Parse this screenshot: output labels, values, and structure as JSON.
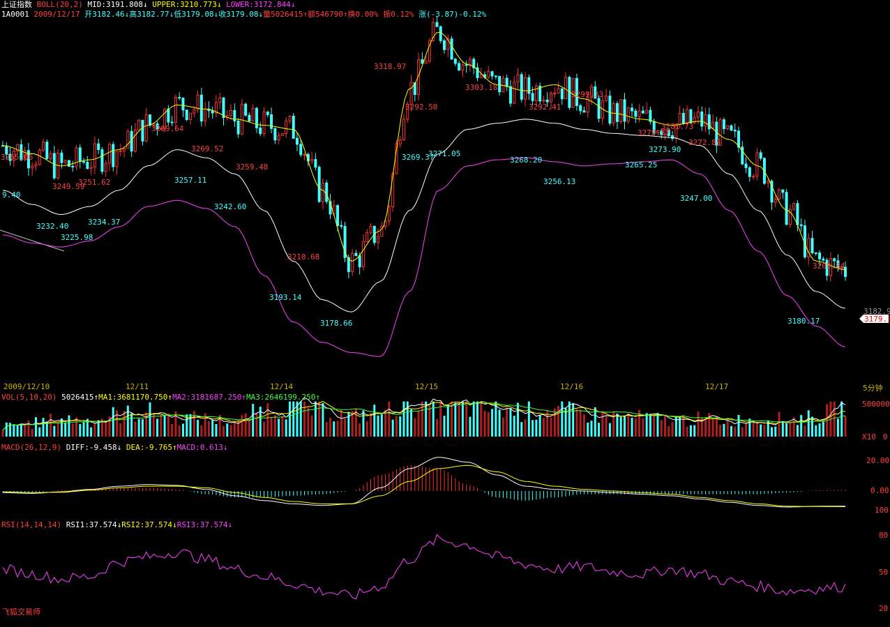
{
  "header": {
    "index_name": "上证指数",
    "boll_label": "BOLL(20,2)",
    "mid": "MID:3191.808↓",
    "upper": "UPPER:3210.773↓",
    "lower": "LOWER:3172.844↓",
    "code": "1A0001",
    "date": "2009/12/17",
    "open": "开3182.46↓",
    "high": "高3182.77↓",
    "low": "低3179.08↓",
    "close": "收3179.08↓",
    "volume": "量5026415↑",
    "amount": "额546790↑",
    "turnover": "换0.00%",
    "amplitude": "振0.12%",
    "change": "涨(-3.87)-0.12%"
  },
  "price_labels": {
    "l1": "3265.06",
    "l2": "9.40",
    "l3": "3249.59",
    "l4": "3251.62",
    "l5": "3232.40",
    "l6": "3225.98",
    "l7": "3234.37",
    "l8": "3289.64",
    "l9": "3269.52",
    "l10": "3257.11",
    "l11": "3259.48",
    "l12": "3242.60",
    "l13": "3210.68",
    "l14": "3193.14",
    "l15": "3178.66",
    "l16": "3318.97",
    "l17": "3292.50",
    "l18": "3269.37",
    "l19": "3271.05",
    "l20": "3303.18",
    "l21": "3292.41",
    "l22": "3268.20",
    "l23": "3256.13",
    "l24": "3299.33",
    "l25": "3278.57",
    "l26": "3281.73",
    "l27": "3273.90",
    "l28": "3265.25",
    "l29": "3272.85",
    "l30": "3247.00",
    "l31": "3205.84",
    "l32": "3180.17"
  },
  "price_axis": {
    "last_price": "3182.9",
    "current_price": "3179.1"
  },
  "date_axis": {
    "d1": "2009/12/10",
    "d2": "12/11",
    "d3": "12/14",
    "d4": "12/15",
    "d5": "12/16",
    "d6": "12/17",
    "period": "5分钟"
  },
  "vol_header": {
    "name": "VOL(5,10,20)",
    "value": "5026415↑",
    "ma1": "MA1:3681170.750↑",
    "ma2": "MA2:3181687.250↑",
    "ma3": "MA3:2646199.250↑"
  },
  "vol_axis": {
    "top": "500000",
    "unit": "X10",
    "zero": "0"
  },
  "macd_header": {
    "name": "MACD(26,12,9)",
    "diff": "DIFF:-9.458↓",
    "dea": "DEA:-9.765↑",
    "macd": "MACD:0.613↓"
  },
  "macd_axis": {
    "top": "20.00",
    "mid": "0.00",
    "bottom": "100"
  },
  "rsi_header": {
    "name": "RSI(14,14,14)",
    "rsi1": "RSI1:37.574↓",
    "rsi2": "RSI2:37.574↓",
    "rsi3": "RSI3:37.574↓"
  },
  "rsi_axis": {
    "top": "80",
    "mid": "50",
    "bottom": "20"
  },
  "watermark": "飞狐交易师",
  "colors": {
    "up": "#ff3030",
    "down": "#40ffff",
    "boll_mid": "#ffffff",
    "boll_upper": "#ffff00",
    "boll_lower": "#ff40ff",
    "diff": "#ffffff",
    "dea": "#ffff00",
    "rsi": "#ff40ff"
  },
  "chart_data": [
    {
      "type": "line",
      "title": "上证指数 BOLL(20,2)",
      "ylim": [
        3165,
        3330
      ],
      "x_labels": [
        "2009/12/10",
        "12/11",
        "12/14",
        "12/15",
        "12/16",
        "12/17"
      ],
      "series": [
        {
          "name": "MID",
          "values": [
            3250,
            3243,
            3238,
            3242,
            3250,
            3262,
            3270,
            3266,
            3258,
            3240,
            3215,
            3196,
            3190,
            3205,
            3240,
            3268,
            3280,
            3283,
            3285,
            3283,
            3280,
            3278,
            3277,
            3276,
            3272,
            3258,
            3240,
            3218,
            3200,
            3191.8
          ]
        },
        {
          "name": "UPPER",
          "values": [
            3272,
            3268,
            3262,
            3265,
            3270,
            3282,
            3292,
            3290,
            3285,
            3282,
            3280,
            3250,
            3215,
            3230,
            3300,
            3328,
            3312,
            3302,
            3299,
            3302,
            3295,
            3288,
            3285,
            3282,
            3284,
            3275,
            3262,
            3240,
            3215,
            3210.8
          ]
        },
        {
          "name": "LOWER",
          "values": [
            3228,
            3224,
            3222,
            3225,
            3232,
            3242,
            3245,
            3241,
            3232,
            3208,
            3185,
            3175,
            3170,
            3168,
            3200,
            3250,
            3262,
            3265,
            3266,
            3264,
            3262,
            3263,
            3264,
            3265,
            3258,
            3240,
            3220,
            3198,
            3183,
            3172.8
          ]
        }
      ]
    },
    {
      "type": "bar",
      "title": "VOL(5,10,20)",
      "ylim": [
        0,
        500000
      ],
      "series": [
        {
          "name": "VOL",
          "values": [
            150000,
            200000,
            260000,
            240000,
            330000,
            360000,
            290000,
            260000,
            220000,
            400000,
            470000,
            380000,
            300000,
            360000,
            500000,
            460000,
            440000,
            410000,
            380000,
            390000,
            340000,
            300000,
            280000,
            250000,
            260000,
            240000,
            250000,
            260000,
            280000,
            502641
          ]
        }
      ]
    },
    {
      "type": "line",
      "title": "MACD(26,12,9)",
      "ylim": [
        -12,
        25
      ],
      "series": [
        {
          "name": "DIFF",
          "values": [
            -1,
            -1.5,
            -0.5,
            1,
            3,
            4,
            3.5,
            1,
            -3,
            -6,
            -8,
            -9,
            -8,
            2,
            14,
            21,
            18,
            10,
            3,
            1,
            0,
            -1,
            -2,
            -3,
            -5,
            -7,
            -9,
            -10,
            -9.5,
            -9.458
          ]
        },
        {
          "name": "DEA",
          "values": [
            -0.5,
            -1,
            -0.8,
            0.5,
            2,
            3,
            3,
            2,
            -1,
            -4,
            -6.5,
            -8,
            -8,
            -3,
            6,
            14,
            16,
            12,
            6,
            3,
            1,
            0,
            -1,
            -2,
            -4,
            -6,
            -8,
            -9.5,
            -9.7,
            -9.765
          ]
        }
      ]
    },
    {
      "type": "line",
      "title": "RSI(14,14,14)",
      "ylim": [
        20,
        80
      ],
      "series": [
        {
          "name": "RSI",
          "values": [
            52,
            48,
            44,
            46,
            58,
            62,
            66,
            60,
            52,
            46,
            40,
            34,
            30,
            38,
            60,
            76,
            72,
            62,
            56,
            52,
            54,
            50,
            48,
            52,
            48,
            42,
            38,
            34,
            36,
            37.574
          ]
        }
      ]
    }
  ]
}
